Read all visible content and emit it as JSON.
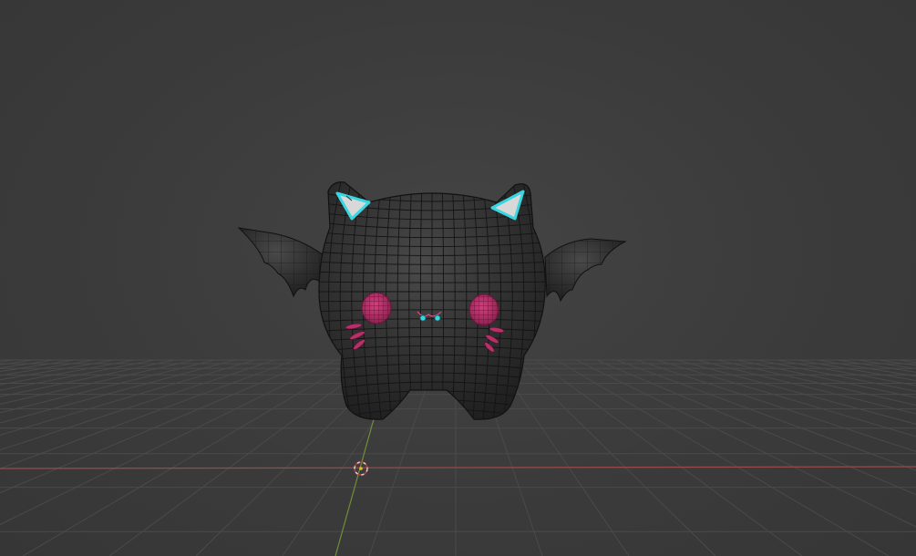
{
  "viewport": {
    "mode": "3d-viewport",
    "object": "bat-cat-creature-mesh",
    "display": "wireframe-overlay",
    "colors": {
      "background": "#3b3b3b",
      "grid": "#4a4a4a",
      "x_axis": "#9a4a4a",
      "y_axis": "#6f8f3a",
      "body": "#2e2e2e",
      "wire": "#151515",
      "ear_highlight": "#38d6e0",
      "cheek": "#b8306a",
      "cursor": "#e8c8c8"
    }
  },
  "icons": {
    "cursor": "3d-cursor-icon"
  }
}
